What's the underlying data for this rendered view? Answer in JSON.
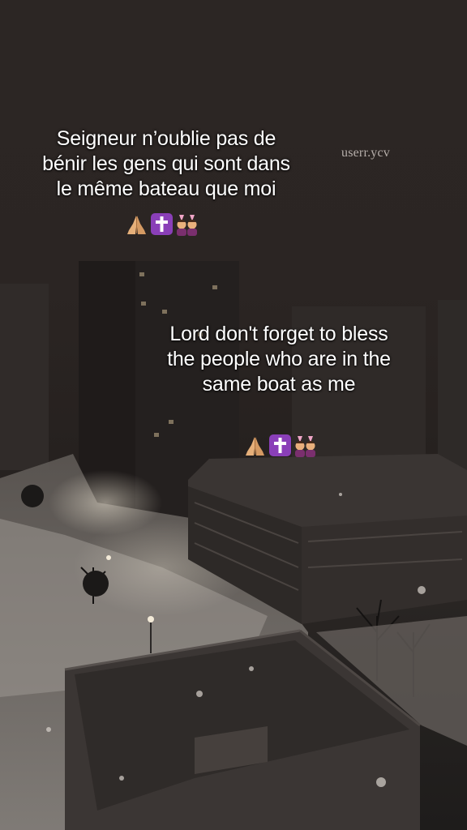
{
  "caption_fr": {
    "lines": [
      "Seigneur n’oublie pas de",
      "bénir les gens qui sont dans",
      "le même bateau que moi"
    ],
    "emojis": [
      "folded-hands-icon",
      "latin-cross-icon",
      "people-with-bunny-ears-icon"
    ]
  },
  "caption_en": {
    "lines": [
      "Lord don't forget to bless",
      "the people who are in the",
      "same boat as me"
    ],
    "emojis": [
      "folded-hands-icon",
      "latin-cross-icon",
      "people-with-bunny-ears-icon"
    ]
  },
  "watermark": "userr.ycv",
  "colors": {
    "caption_text": "#ffffff",
    "cross_square": "#8a3fb8",
    "sky": "#2b2523",
    "snow": "#9b958f"
  }
}
